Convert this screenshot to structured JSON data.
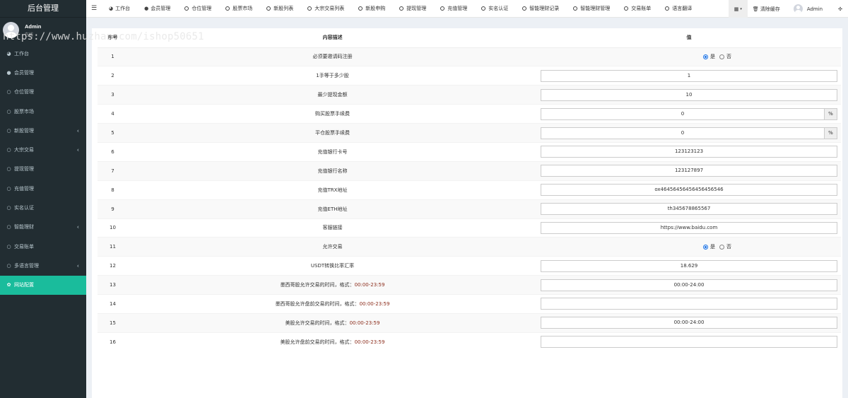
{
  "brand": "后台管理",
  "user": {
    "name": "Admin",
    "status": "在线"
  },
  "watermark": "https://www.huzhan.com/ishop50651",
  "sidebar": {
    "items": [
      {
        "label": "工作台",
        "icon": "dashboard-icon",
        "glyph": "◕",
        "has_children": false
      },
      {
        "label": "会员管理",
        "icon": "user-icon",
        "glyph": "●",
        "has_children": false
      },
      {
        "label": "仓位管理",
        "icon": "circle-icon",
        "glyph": "○",
        "has_children": false
      },
      {
        "label": "股票市场",
        "icon": "circle-icon",
        "glyph": "○",
        "has_children": false
      },
      {
        "label": "新股管理",
        "icon": "circle-icon",
        "glyph": "○",
        "has_children": true
      },
      {
        "label": "大宗交易",
        "icon": "circle-icon",
        "glyph": "○",
        "has_children": true
      },
      {
        "label": "提现管理",
        "icon": "circle-icon",
        "glyph": "○",
        "has_children": false
      },
      {
        "label": "充值管理",
        "icon": "circle-icon",
        "glyph": "○",
        "has_children": false
      },
      {
        "label": "实名认证",
        "icon": "circle-icon",
        "glyph": "○",
        "has_children": false
      },
      {
        "label": "智能理财",
        "icon": "circle-icon",
        "glyph": "○",
        "has_children": true
      },
      {
        "label": "交易账单",
        "icon": "circle-icon",
        "glyph": "○",
        "has_children": false
      },
      {
        "label": "多语言管理",
        "icon": "circle-icon",
        "glyph": "○",
        "has_children": true
      },
      {
        "label": "网站配置",
        "icon": "gear-icon",
        "glyph": "✿",
        "has_children": false,
        "active": true
      }
    ]
  },
  "topnav": {
    "items": [
      {
        "label": "工作台",
        "icon": "dashboard-icon",
        "glyph": "◕"
      },
      {
        "label": "会员管理",
        "icon": "user-icon",
        "glyph": "●"
      },
      {
        "label": "仓位管理",
        "icon": "circle-icon"
      },
      {
        "label": "股票市场",
        "icon": "circle-icon"
      },
      {
        "label": "新股列表",
        "icon": "circle-icon"
      },
      {
        "label": "大宗交易列表",
        "icon": "circle-icon"
      },
      {
        "label": "新股申购",
        "icon": "circle-icon"
      },
      {
        "label": "提现管理",
        "icon": "circle-icon"
      },
      {
        "label": "充值管理",
        "icon": "circle-icon"
      },
      {
        "label": "实名认证",
        "icon": "circle-icon"
      },
      {
        "label": "智能理财记录",
        "icon": "circle-icon"
      },
      {
        "label": "智能理财管理",
        "icon": "circle-icon"
      },
      {
        "label": "交易账单",
        "icon": "circle-icon"
      },
      {
        "label": "语言翻译",
        "icon": "circle-icon"
      }
    ],
    "clear_cache": "清除缓存",
    "admin_name": "Admin"
  },
  "table": {
    "headers": {
      "index": "序号",
      "desc": "内容描述",
      "value": "值"
    },
    "rows": [
      {
        "index": "1",
        "desc": "必须要邀请码注册",
        "type": "radio",
        "options": [
          "是",
          "否"
        ],
        "selected": "是"
      },
      {
        "index": "2",
        "desc": "1手等于多少股",
        "type": "input",
        "value": "1"
      },
      {
        "index": "3",
        "desc": "最少提现金额",
        "type": "input",
        "value": "10"
      },
      {
        "index": "4",
        "desc": "购买股票手续费",
        "type": "input-addon",
        "value": "0",
        "addon": "%"
      },
      {
        "index": "5",
        "desc": "平仓股票手续费",
        "type": "input-addon",
        "value": "0",
        "addon": "%"
      },
      {
        "index": "6",
        "desc": "充值银行卡号",
        "type": "input",
        "value": "123123123"
      },
      {
        "index": "7",
        "desc": "充值银行名称",
        "type": "input",
        "value": "123127897"
      },
      {
        "index": "8",
        "desc": "充值TRX地址",
        "type": "input",
        "value": "ox46456456456456456546"
      },
      {
        "index": "9",
        "desc": "充值ETH地址",
        "type": "input",
        "value": "th345678865567"
      },
      {
        "index": "10",
        "desc": "客服链接",
        "type": "input",
        "value": "https://www.baidu.com"
      },
      {
        "index": "11",
        "desc": "允许交易",
        "type": "radio",
        "options": [
          "是",
          "否"
        ],
        "selected": "是"
      },
      {
        "index": "12",
        "desc": "USDT转换比率汇率",
        "type": "input",
        "value": "18.629"
      },
      {
        "index": "13",
        "desc": "墨西哥股允许交易的时间，格式：",
        "desc_hl": "00:00-23:59",
        "type": "input",
        "value": "00:00-24:00"
      },
      {
        "index": "14",
        "desc": "墨西哥股允许盘前交易的时间，格式：",
        "desc_hl": "00:00-23:59",
        "type": "input",
        "value": ""
      },
      {
        "index": "15",
        "desc": "美股允许交易的时间，格式：",
        "desc_hl": "00:00-23:59",
        "type": "input",
        "value": "00:00-24:00"
      },
      {
        "index": "16",
        "desc": "美股允许盘前交易的时间，格式：",
        "desc_hl": "00:00-23:59",
        "type": "input",
        "value": ""
      }
    ]
  },
  "colors": {
    "sidebar_bg": "#222d32",
    "active_menu": "#1abc9c",
    "highlight_text": "#8b2c1b",
    "radio_selected": "#1a73e8"
  }
}
